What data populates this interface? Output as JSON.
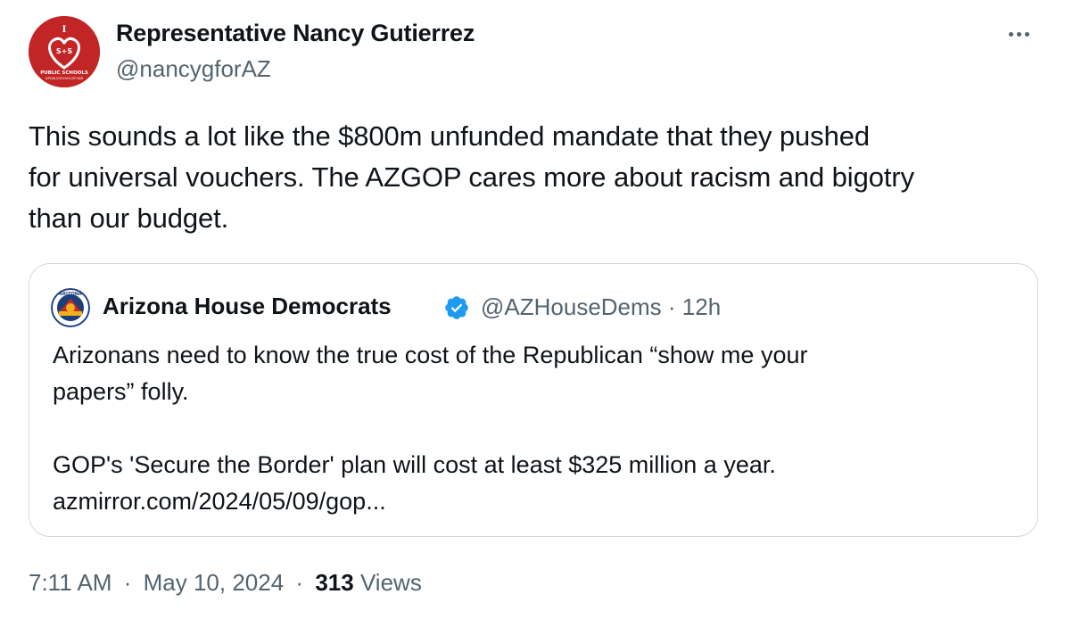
{
  "author": {
    "name": "Representative Nancy Gutierrez",
    "handle": "@nancygforAZ",
    "avatar_text": "I S+S PUBLIC SCHOOLS",
    "avatar_color": "#c8252a"
  },
  "tweet": {
    "text_lines": [
      "This sounds a lot like the $800m unfunded mandate that they pushed",
      "for universal vouchers. The AZGOP cares more about racism and bigotry",
      "than our budget."
    ]
  },
  "quote": {
    "name": "Arizona House Democrats",
    "handle_time": "@AZHouseDems · 12h",
    "verified_color": "#1d9bf0",
    "text_lines": [
      "Arizonans need to know the true cost of the Republican “show me your",
      "papers” folly.",
      "",
      "GOP's 'Secure the Border' plan will cost at least $325 million a year.",
      "azmirror.com/2024/05/09/gop..."
    ]
  },
  "meta": {
    "time": "7:11 AM",
    "date": "May 10, 2024",
    "views_count": "313",
    "views_label": "Views",
    "separator": "·"
  },
  "icons": {
    "more": "more-horizontal-icon",
    "verified": "verified-badge-icon"
  }
}
